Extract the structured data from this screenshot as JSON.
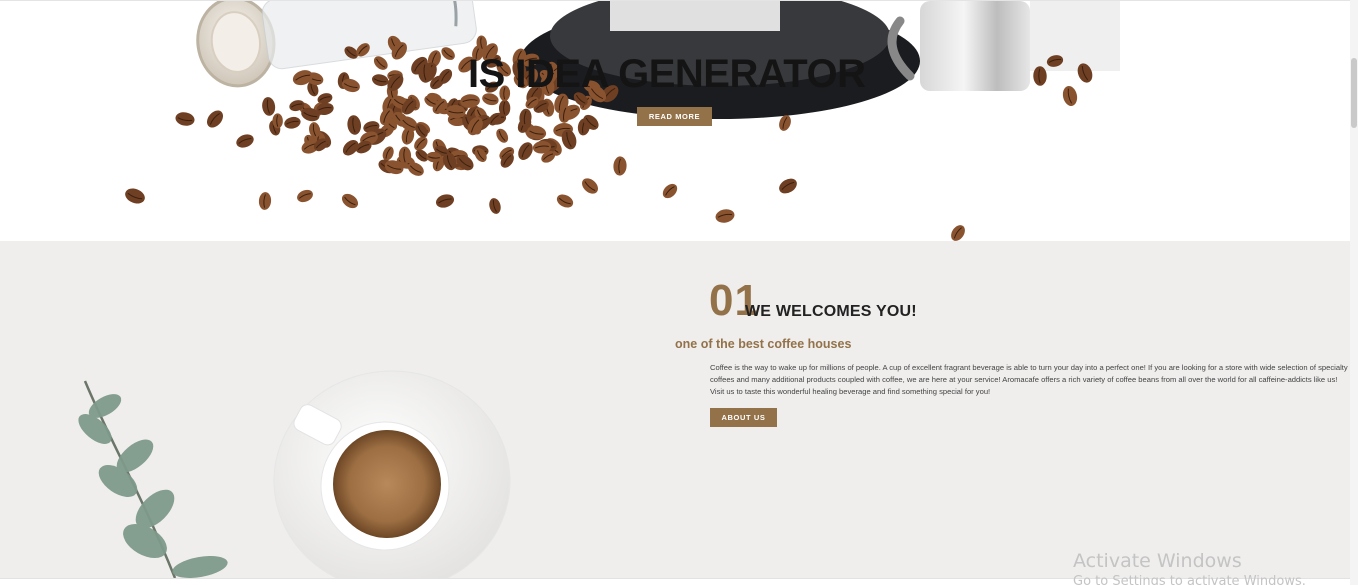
{
  "hero": {
    "title": "IS IDEA GENERATOR",
    "button_label": "READ MORE"
  },
  "about": {
    "number": "01",
    "heading": "WE WELCOMES YOU!",
    "subtitle": "one of the best coffee houses",
    "body": "Coffee is the way to wake up for millions of people. A cup of excellent fragrant beverage is able to turn your day into a perfect one! If you are looking for a store with wide selection of specialty coffees and many additional products coupled with coffee, we are here at your service! Aromacafe offers a rich variety of coffee beans from all over the world for all caffeine-addicts like us! Visit us to taste this wonderful healing beverage and find something special for you!",
    "button_label": "ABOUT US"
  },
  "watermark": {
    "line1": "Activate Windows",
    "line2": "Go to Settings to activate Windows."
  },
  "colors": {
    "accent": "#93724a",
    "hero_bg": "#ffffff",
    "about_bg": "#efeeed"
  }
}
